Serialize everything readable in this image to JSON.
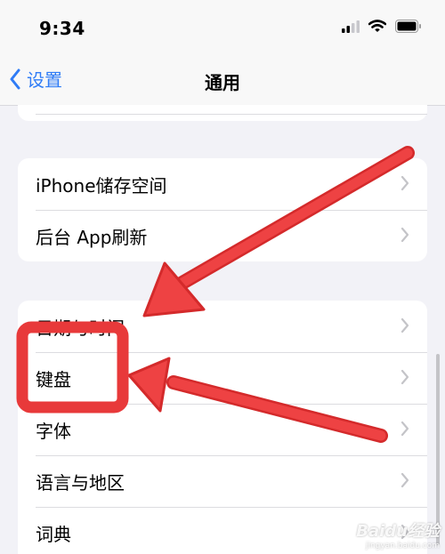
{
  "status_bar": {
    "time": "9:34"
  },
  "nav": {
    "back_label": "设置",
    "title": "通用"
  },
  "group1": {
    "items": [
      {
        "label": "iPhone储存空间"
      },
      {
        "label": "后台 App刷新"
      }
    ]
  },
  "group2": {
    "items": [
      {
        "label": "日期与时间"
      },
      {
        "label": "键盘"
      },
      {
        "label": "字体"
      },
      {
        "label": "语言与地区"
      },
      {
        "label": "词典"
      }
    ]
  },
  "colors": {
    "accent": "#2f7cf6",
    "annotation": "#e8393a",
    "background": "#f2f2f7"
  },
  "watermark": {
    "logo": "Baidu经验",
    "url": "jingyan.baidu.com"
  }
}
